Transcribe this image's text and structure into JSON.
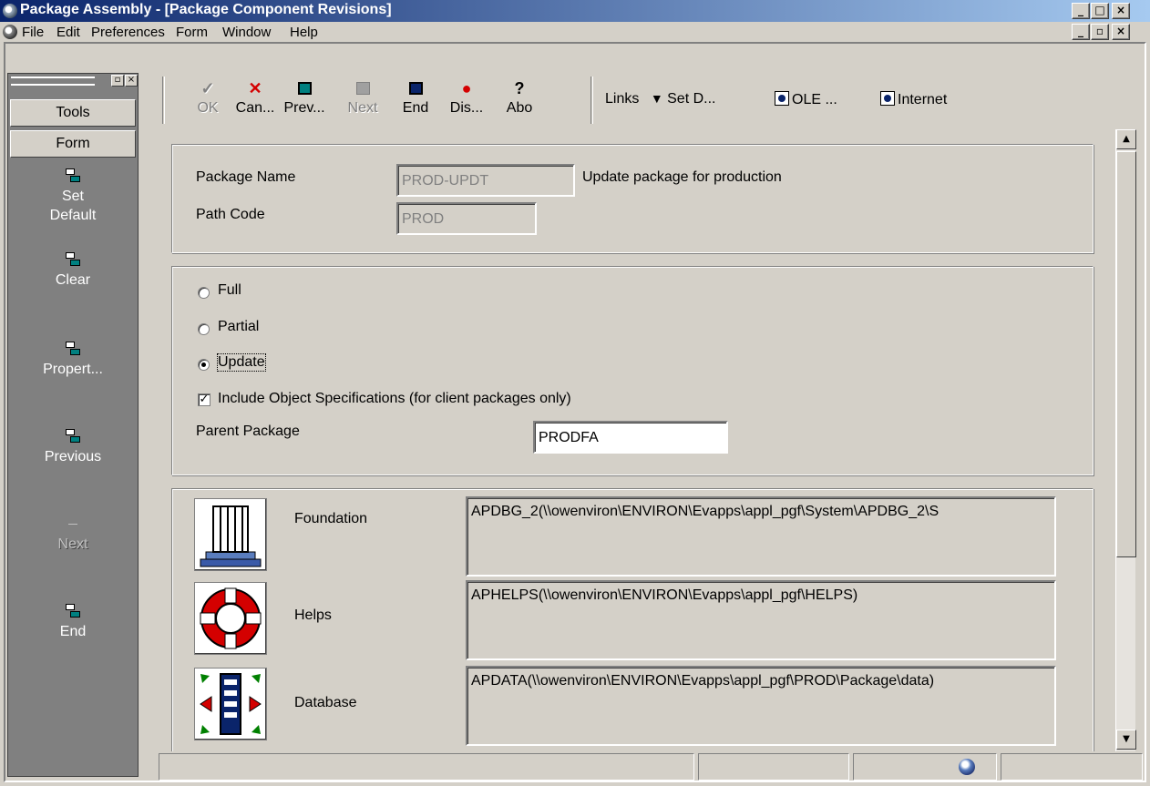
{
  "window": {
    "title": "Package Assembly - [Package Component Revisions]",
    "controls": [
      "_",
      "□",
      "×"
    ],
    "mdi_controls": [
      "_",
      "▫",
      "×"
    ]
  },
  "menu": [
    "File",
    "Edit",
    "Preferences",
    "Form",
    "Window",
    "Help"
  ],
  "exit_bar": {
    "tabs": [
      "Tools",
      "Form"
    ],
    "items": [
      {
        "label": "Set\nDefault",
        "icon": "form-exit-icon",
        "enabled": true
      },
      {
        "label": "Clear",
        "icon": "form-exit-icon",
        "enabled": true
      },
      {
        "label": "Propert...",
        "icon": "form-exit-icon",
        "enabled": true
      },
      {
        "label": "Previous",
        "icon": "form-exit-icon",
        "enabled": true
      },
      {
        "label": "Next",
        "icon": "form-exit-icon",
        "enabled": false
      },
      {
        "label": "End",
        "icon": "form-exit-icon",
        "enabled": true
      }
    ]
  },
  "toolbar": {
    "buttons": [
      {
        "label": "OK",
        "icon": "checkmark-icon",
        "enabled": false
      },
      {
        "label": "Can...",
        "icon": "cancel-x-icon",
        "enabled": true
      },
      {
        "label": "Prev...",
        "icon": "previous-icon",
        "enabled": true
      },
      {
        "label": "Next",
        "icon": "next-icon",
        "enabled": false
      },
      {
        "label": "End",
        "icon": "end-icon",
        "enabled": true
      },
      {
        "label": "Dis...",
        "icon": "display-errors-icon",
        "enabled": true
      },
      {
        "label": "Abo",
        "icon": "about-help-icon",
        "enabled": true
      }
    ],
    "links_label": "Links",
    "set_default": "Set D...",
    "ole": "OLE ...",
    "internet": "Internet"
  },
  "header": {
    "package_name_label": "Package Name",
    "package_name_value": "PROD-UPDT",
    "package_description": "Update package for production",
    "path_code_label": "Path Code",
    "path_code_value": "PROD"
  },
  "options": {
    "full_label": "Full",
    "partial_label": "Partial",
    "update_label": "Update",
    "selected": "Update",
    "include_specs_label": "Include Object Specifications (for client packages only)",
    "include_specs_checked": true,
    "parent_package_label": "Parent Package",
    "parent_package_value": "PRODFA"
  },
  "components": [
    {
      "name": "Foundation",
      "icon": "foundation-column-icon",
      "value": "APDBG_2(\\\\owenviron\\ENVIRON\\Evapps\\appl_pgf\\System\\APDBG_2\\S"
    },
    {
      "name": "Helps",
      "icon": "lifebuoy-icon",
      "value": "APHELPS(\\\\owenviron\\ENVIRON\\Evapps\\appl_pgf\\HELPS)"
    },
    {
      "name": "Database",
      "icon": "database-icon",
      "value": "APDATA(\\\\owenviron\\ENVIRON\\Evapps\\appl_pgf\\PROD\\Package\\data)"
    }
  ]
}
